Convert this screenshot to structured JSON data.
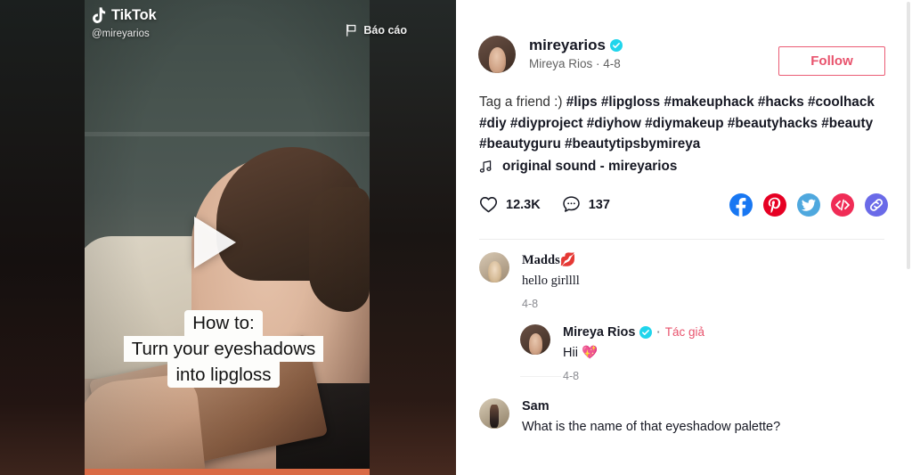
{
  "video": {
    "brand_name": "TikTok",
    "handle": "@mireyarios",
    "report_label": "Báo cáo",
    "caption_lines": [
      "How to:",
      "Turn your eyeshadows",
      "into lipgloss"
    ],
    "progress_percent": 100,
    "progress_color": "#d96a45"
  },
  "author": {
    "username": "mireyarios",
    "display_name_and_date": "Mireya Rios · 4-8",
    "verified": true,
    "follow_label": "Follow",
    "follow_color": "#e8536d"
  },
  "description": {
    "prefix": "Tag a friend :) ",
    "hashtags": "#lips #lipgloss #makeuphack #hacks #coolhack #diy #diyproject #diyhow #diymakeup #beautyhacks #beauty #beautyguru #beautytipsbymireya"
  },
  "sound": {
    "icon": "music-note-icon",
    "label": "original sound - mireyarios"
  },
  "stats": {
    "like_icon": "heart-icon",
    "likes": "12.3K",
    "comment_icon": "comment-bubble-icon",
    "comments": "137"
  },
  "share": {
    "items": [
      {
        "name": "facebook-share-icon",
        "color": "#1877F2"
      },
      {
        "name": "pinterest-share-icon",
        "color": "#E60023"
      },
      {
        "name": "twitter-share-icon",
        "color": "#4FA8DE"
      },
      {
        "name": "embed-code-icon",
        "color": "#F02C56"
      },
      {
        "name": "copy-link-icon",
        "color": "#6A6AE8"
      }
    ]
  },
  "comments": [
    {
      "name": "Madds💋",
      "text": "hello girllll",
      "date": "4-8",
      "verified": false,
      "author_tag": null,
      "reply": {
        "name": "Mireya Rios",
        "verified": true,
        "author_tag": "Tác giả",
        "text": "Hii 💖",
        "date": "4-8"
      }
    },
    {
      "name": "Sam",
      "text": "What is the name of that eyeshadow palette?",
      "date": "",
      "verified": false,
      "author_tag": null,
      "reply": null
    }
  ]
}
